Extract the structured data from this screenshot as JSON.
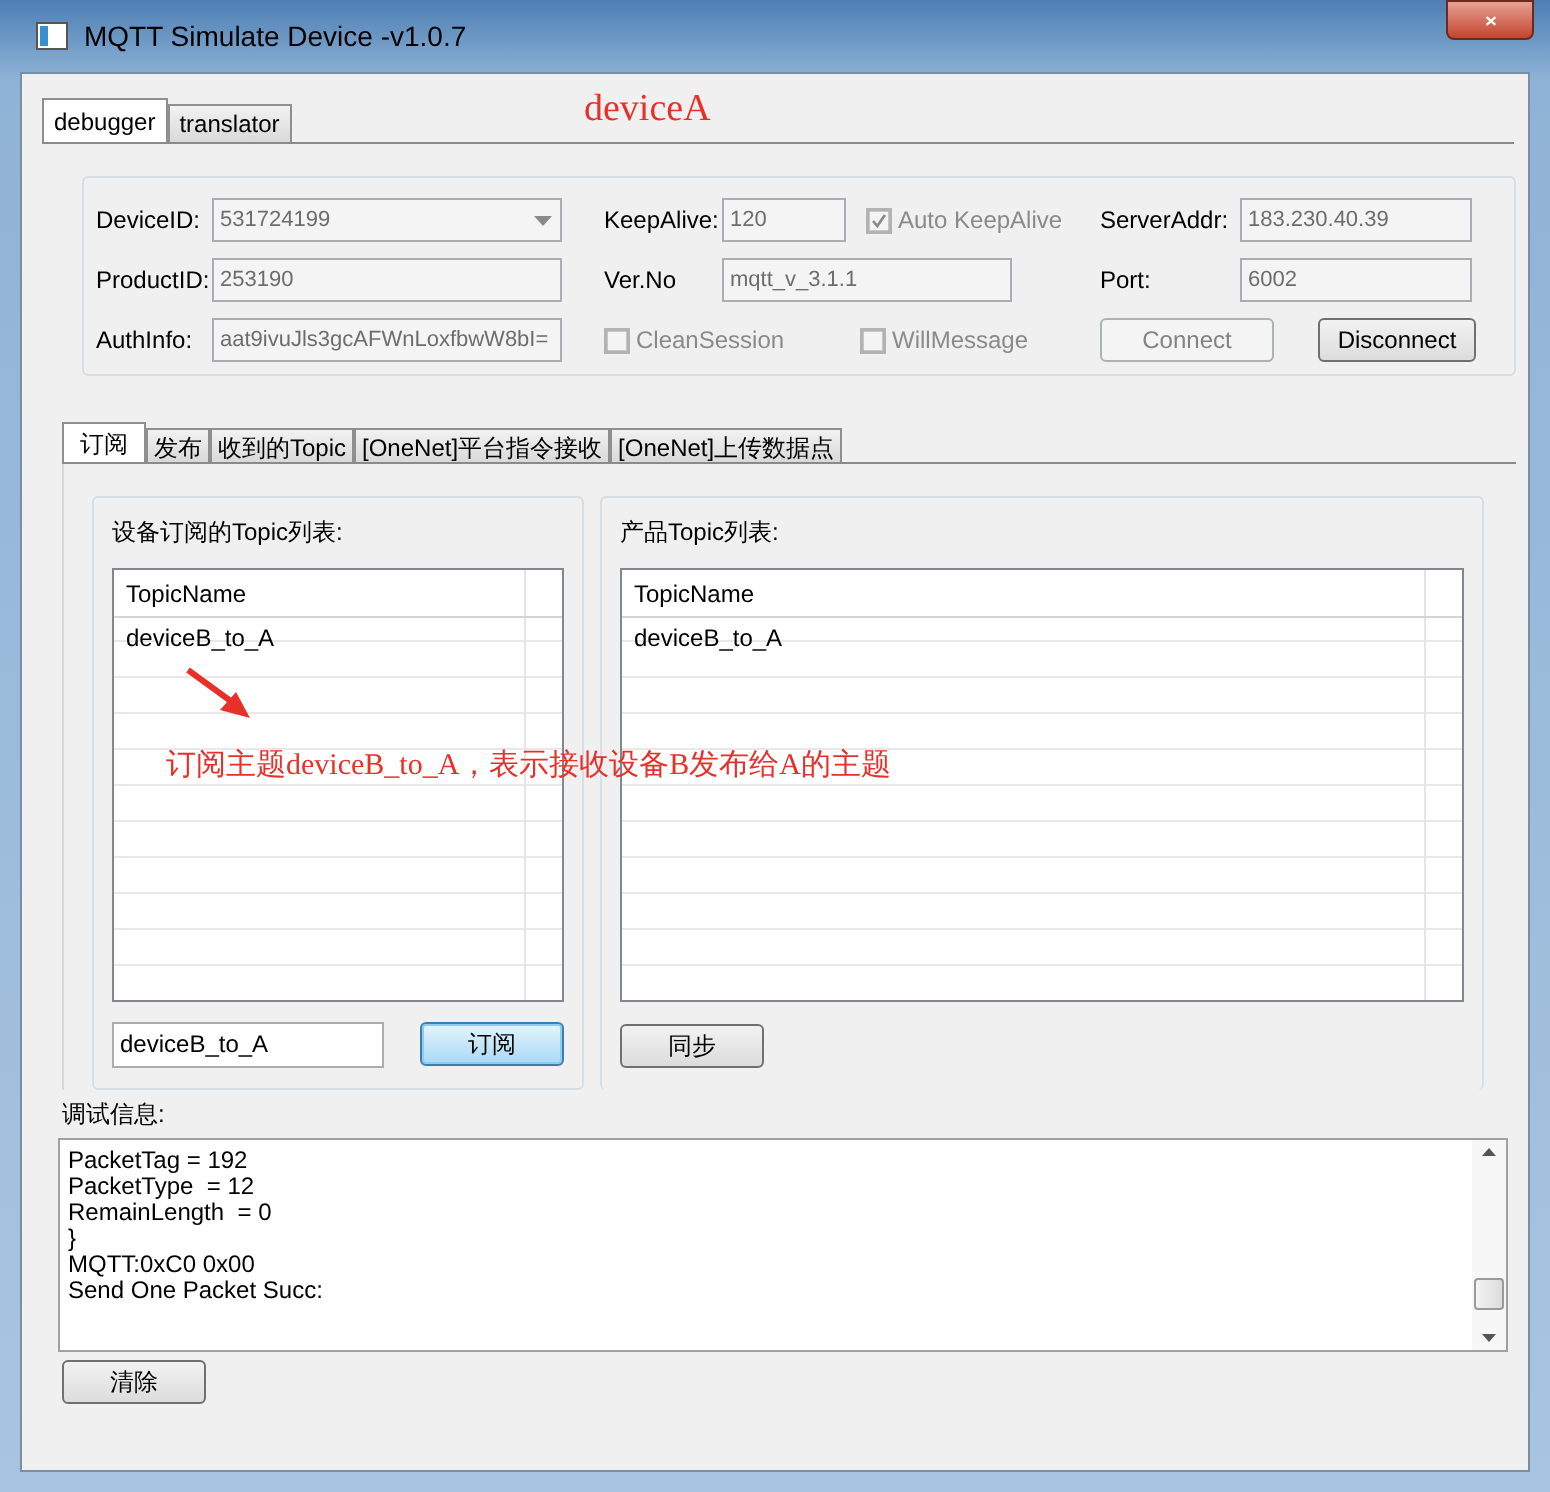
{
  "window": {
    "title": "MQTT Simulate Device  -v1.0.7"
  },
  "main_tabs": [
    {
      "label": "debugger",
      "selected": true
    },
    {
      "label": "translator",
      "selected": false
    }
  ],
  "connection": {
    "columns": [
      [
        {
          "kind": "combo",
          "label": "DeviceID:",
          "value": "531724199",
          "disabled": true
        },
        {
          "kind": "field",
          "label": "ProductID:",
          "value": "253190",
          "disabled": true
        },
        {
          "kind": "field",
          "label": "AuthInfo:",
          "value": "aat9ivuJls3gcAFWnLoxfbwW8bI=",
          "disabled": true
        }
      ],
      [
        {
          "kind": "field_check",
          "label": "KeepAlive:",
          "value": "120",
          "disabled": true,
          "check": {
            "label": "Auto KeepAlive",
            "checked": true,
            "disabled": true
          }
        },
        {
          "kind": "field",
          "label": "Ver.No",
          "value": "mqtt_v_3.1.1",
          "disabled": true
        },
        {
          "kind": "checks",
          "checks": [
            {
              "label": "CleanSession",
              "checked": false,
              "disabled": true
            },
            {
              "label": "WillMessage",
              "checked": false,
              "disabled": true
            }
          ]
        }
      ],
      [
        {
          "kind": "field",
          "label": "ServerAddr:",
          "value": "183.230.40.39",
          "disabled": true
        },
        {
          "kind": "field",
          "label": "Port:",
          "value": "6002",
          "disabled": true
        },
        {
          "kind": "buttons",
          "buttons": [
            {
              "label": "Connect",
              "disabled": true
            },
            {
              "label": "Disconnect",
              "disabled": false
            }
          ]
        }
      ]
    ]
  },
  "sub_tabs": [
    {
      "label": "订阅",
      "selected": true
    },
    {
      "label": "发布",
      "selected": false
    },
    {
      "label": "收到的Topic",
      "selected": false
    },
    {
      "label": "[OneNet]平台指令接收",
      "selected": false
    },
    {
      "label": "[OneNet]上传数据点",
      "selected": false
    }
  ],
  "panels": [
    {
      "title": "设备订阅的Topic列表:",
      "columns": [
        "TopicName"
      ],
      "rows": [
        "deviceB_to_A"
      ],
      "input": {
        "value": "deviceB_to_A"
      },
      "button": {
        "label": "订阅",
        "focused": true
      }
    },
    {
      "title": "产品Topic列表:",
      "columns": [
        "TopicName"
      ],
      "rows": [
        "deviceB_to_A"
      ],
      "button": {
        "label": "同步",
        "focused": false
      }
    }
  ],
  "debug": {
    "title": "调试信息:",
    "lines": [
      "PacketTag = 192",
      "PacketType  = 12",
      "RemainLength  = 0",
      "}",
      "MQTT:0xC0 0x00",
      "Send One Packet Succ:"
    ],
    "clear_button": "清除"
  },
  "annotations": [
    {
      "kind": "heading",
      "text": "deviceA"
    },
    {
      "kind": "note",
      "text": "订阅主题deviceB_to_A，表示接收设备B发布给A的主题"
    }
  ]
}
